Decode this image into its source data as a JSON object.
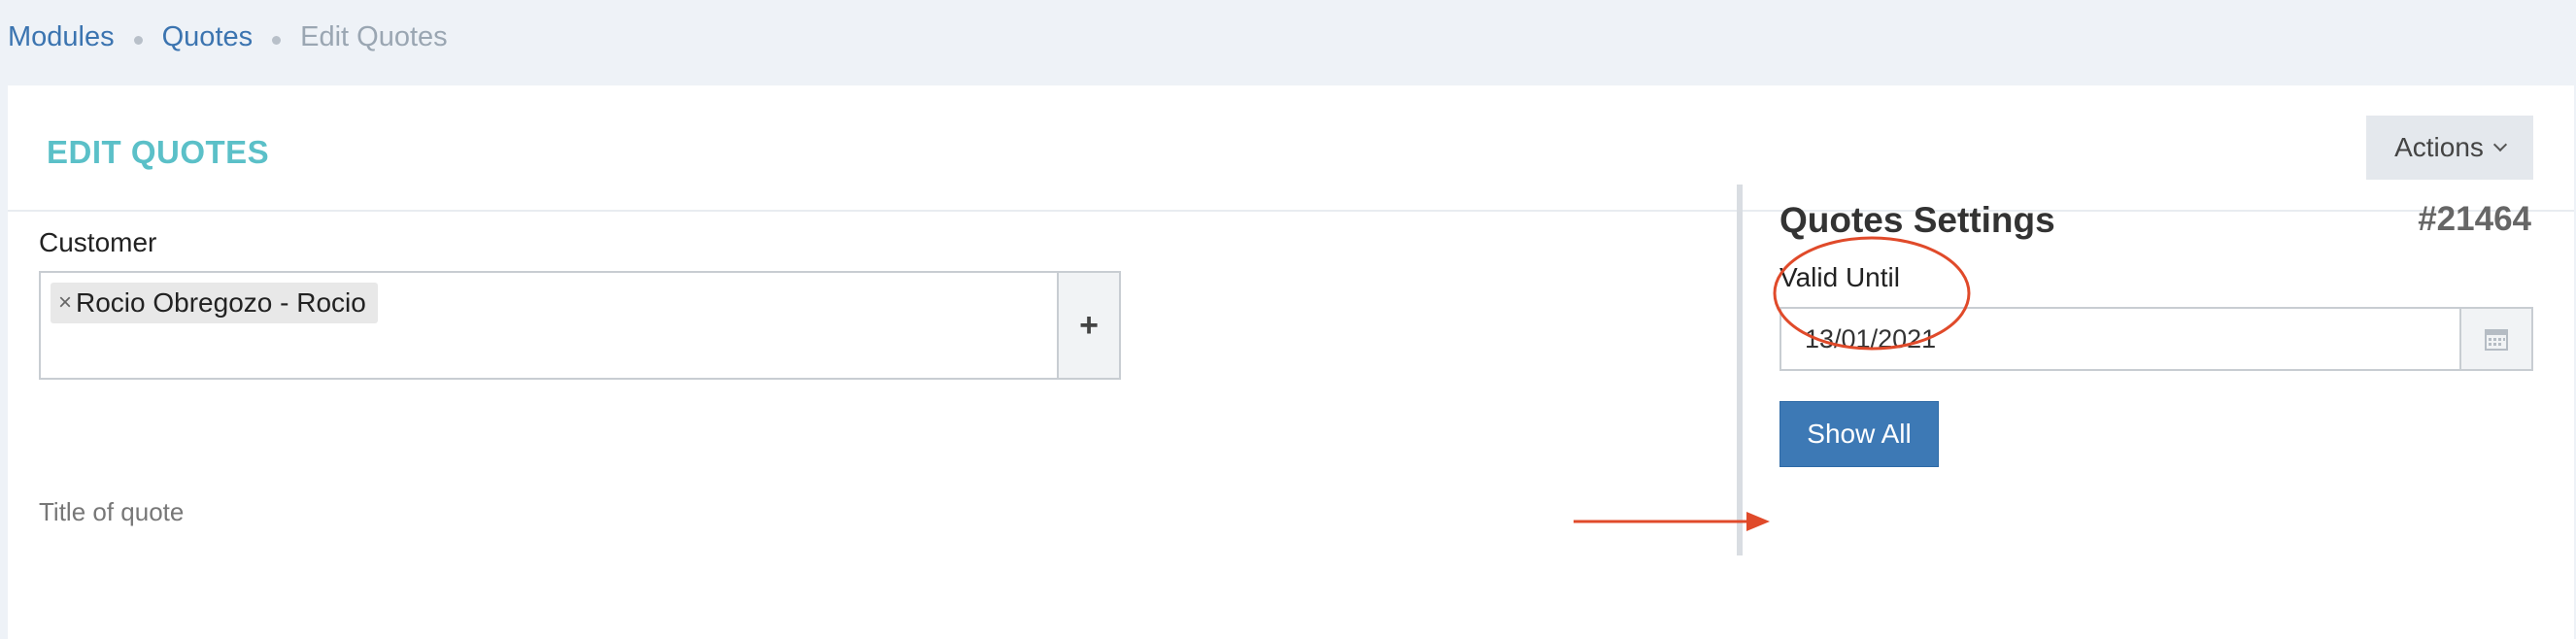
{
  "breadcrumb": {
    "items": [
      {
        "label": "Modules"
      },
      {
        "label": "Quotes"
      },
      {
        "label": "Edit Quotes"
      }
    ]
  },
  "header": {
    "title": "EDIT QUOTES",
    "actions_label": "Actions"
  },
  "customer": {
    "label": "Customer",
    "selected_tag": "Rocio Obregozo - Rocio",
    "remove_symbol": "×",
    "add_symbol": "+"
  },
  "title_of_quote": {
    "label": "Title of quote"
  },
  "settings": {
    "title": "Quotes Settings",
    "quote_number": "#21464",
    "valid_until_label": "Valid Until",
    "valid_until_value": "13/01/2021",
    "show_all_label": "Show All"
  },
  "colors": {
    "accent": "#5bc0c8",
    "primary_button": "#3d79b5",
    "annotation": "#e04a2a",
    "link": "#3b74b0"
  }
}
